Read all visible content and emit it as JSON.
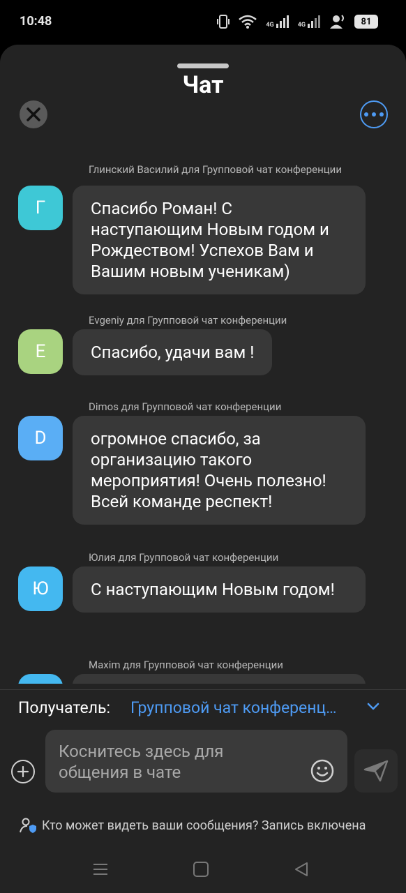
{
  "status_bar": {
    "time": "10:48",
    "network_labels": [
      "4G",
      "4G"
    ],
    "battery": "81"
  },
  "header": {
    "title": "Чат",
    "close_icon": "close-icon",
    "more_icon": "more-options-icon"
  },
  "messages": [
    {
      "sender": "Глинский Василий для Групповой чат конференции",
      "avatar_letter": "Г",
      "avatar_color": "#3ec8d6",
      "text": "Спасибо Роман! С наступающим  Новым годом и Рождеством! Успехов Вам и Вашим новым ученикам)"
    },
    {
      "sender": "Evgeniy для Групповой чат конференции",
      "avatar_letter": "E",
      "avatar_color": "#a9d380",
      "text": "Спасибо, удачи вам !"
    },
    {
      "sender": "Dimos для Групповой чат конференции",
      "avatar_letter": "D",
      "avatar_color": "#5aaef5",
      "text": "огромное спасибо, за организацию такого мероприятия! Очень полезно! Всей команде респект!"
    },
    {
      "sender": "Юлия для Групповой чат конференции",
      "avatar_letter": "Ю",
      "avatar_color": "#44b8f0",
      "text": "С наступающим Новым годом!"
    },
    {
      "sender": "Maxim для Групповой чат конференции",
      "avatar_letter": "",
      "avatar_color": "#44b8f0",
      "text": ""
    }
  ],
  "recipient": {
    "label": "Получатель:",
    "value": "Групповой чат конференц…"
  },
  "composer": {
    "placeholder": "Коснитесь здесь для общения в чате"
  },
  "privacy": {
    "text": "Кто может видеть ваши сообщения? Запись включена"
  },
  "colors": {
    "accent": "#4e9bf4",
    "sheet_bg": "#232323",
    "bubble_bg": "#383838"
  }
}
